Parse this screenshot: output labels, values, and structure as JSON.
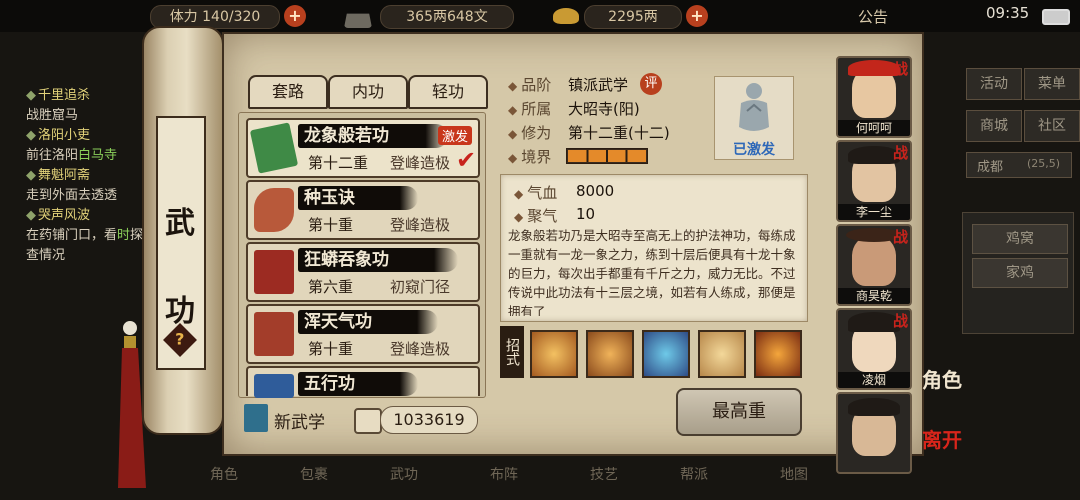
{
  "topbar": {
    "stamina": "体力 140/320",
    "money": "365两648文",
    "gold": "2295两",
    "notice": "公告",
    "time": "09:35"
  },
  "quests": [
    {
      "title": "千里追杀",
      "desc": "战胜窟马"
    },
    {
      "title": "洛阳小吏",
      "desc_pre": "前往洛阳",
      "desc_hl": "白马寺"
    },
    {
      "title": "舞魁阿斋",
      "desc": "走到外面去透透"
    },
    {
      "title": "哭声风波",
      "desc_pre": "在药铺门口，看",
      "desc_hl": "时",
      "desc_post": "探查情况"
    }
  ],
  "scroll": {
    "title": "武功",
    "help": "?"
  },
  "tabs": [
    "套路",
    "内功",
    "轻功"
  ],
  "skills": [
    {
      "name": "龙象般若功",
      "level": "第十二重",
      "state": "登峰造极",
      "badge": "激发",
      "selected": true,
      "color": "#3f8a46"
    },
    {
      "name": "种玉诀",
      "level": "第十重",
      "state": "登峰造极",
      "color": "#b8593a"
    },
    {
      "name": "狂蟒吞象功",
      "level": "第六重",
      "state": "初窥门径",
      "color": "#9c2b22"
    },
    {
      "name": "浑天气功",
      "level": "第十重",
      "state": "登峰造极",
      "color": "#a33d2a"
    },
    {
      "name": "五行功",
      "level": "",
      "state": "",
      "color": "#2f5c9a"
    }
  ],
  "bottom": {
    "new_skill": "新武学",
    "points": "1033619"
  },
  "info": {
    "grade_label": "品阶",
    "grade": "镇派武学",
    "grade_badge": "评",
    "school_label": "所属",
    "school": "大昭寺(阳)",
    "cultivation_label": "修为",
    "cultivation": "第十二重(十二)",
    "realm_label": "境界",
    "realm_level": 4,
    "activated": "已激发",
    "hp_label": "气血",
    "hp": "8000",
    "qi_label": "聚气",
    "qi": "10",
    "description": "龙象般若功乃是大昭寺至高无上的护法神功，每练成一重就有一龙一象之力，练到十层后便具有十龙十象的巨力，每次出手都重有千斤之力，威力无比。不过传说中此功法有十三层之境，如若有人练成，那便是拥有了",
    "moves_label": "招式",
    "max_button": "最高重"
  },
  "characters": [
    {
      "name": "何呵呵",
      "tag": "战"
    },
    {
      "name": "李一尘",
      "tag": "战"
    },
    {
      "name": "商昊乾",
      "tag": "战"
    },
    {
      "name": "凌烟",
      "tag": "战"
    },
    {
      "name": "",
      "tag": ""
    }
  ],
  "side_labels": {
    "role": "角色",
    "leave": "离开"
  },
  "right_menu": {
    "activity": "活动",
    "menu": "菜单",
    "mall": "商城",
    "community": "社区",
    "city": "成都",
    "coords": "(25,5)",
    "nest": "鸡窝",
    "chicken": "家鸡"
  },
  "bottom_icons": [
    "角色",
    "包裹",
    "武功",
    "布阵",
    "技艺",
    "帮派",
    "地图"
  ]
}
